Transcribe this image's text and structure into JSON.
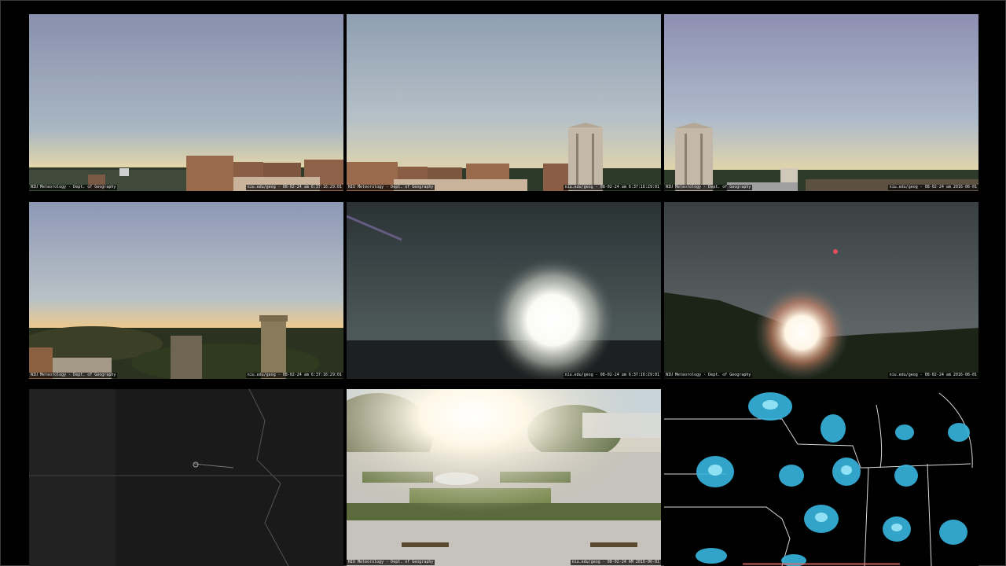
{
  "window": {
    "title": ""
  },
  "cams": [
    {
      "name": "cam-west",
      "left_caption": "NIU Meteorology - Dept. of Geography",
      "right_caption": "niu.edu/geog - 08-02-24 am 6:37:16:29:01"
    },
    {
      "name": "cam-south",
      "left_caption": "NIU Meteorology - Dept. of Geography",
      "right_caption": "niu.edu/geog - 08-02-24 am 6:37:16:29:01"
    },
    {
      "name": "cam-southeast",
      "left_caption": "NIU Meteorology - Dept. of Geography",
      "right_caption": "niu.edu/geog - 08-02-24 am 2016-06-01"
    },
    {
      "name": "cam-northwest",
      "left_caption": "NIU Meteorology - Dept. of Geography",
      "right_caption": "niu.edu/geog - 08-02-24 am 6:37:16:29:01"
    },
    {
      "name": "cam-east-sun",
      "left_caption": "",
      "right_caption": "niu.edu/geog - 08-02-24 am 6:37:16:29:01"
    },
    {
      "name": "cam-northeast-sun",
      "left_caption": "NIU Meteorology - Dept. of Geography",
      "right_caption": "niu.edu/geog - 08-02-24 am 2016-06-01"
    },
    {
      "name": "satellite",
      "left_caption": "",
      "right_caption": ""
    },
    {
      "name": "cam-plaza",
      "left_caption": "NIU Meteorology - Dept. of Geography",
      "right_caption": "niu.edu/geog - 08-02-24 AM 2016-06-01"
    },
    {
      "name": "radar",
      "left_caption": "",
      "right_caption": ""
    }
  ],
  "colors": {
    "sky_top": "#8a94b0",
    "sky_horizon": "#e9d5a4",
    "building_brick": "#9a6a4c",
    "tower": "#c4b9a8",
    "radar_echo": "#38b6e0",
    "radar_bright": "#a8f0ff",
    "map_line": "#d8d8d8"
  }
}
